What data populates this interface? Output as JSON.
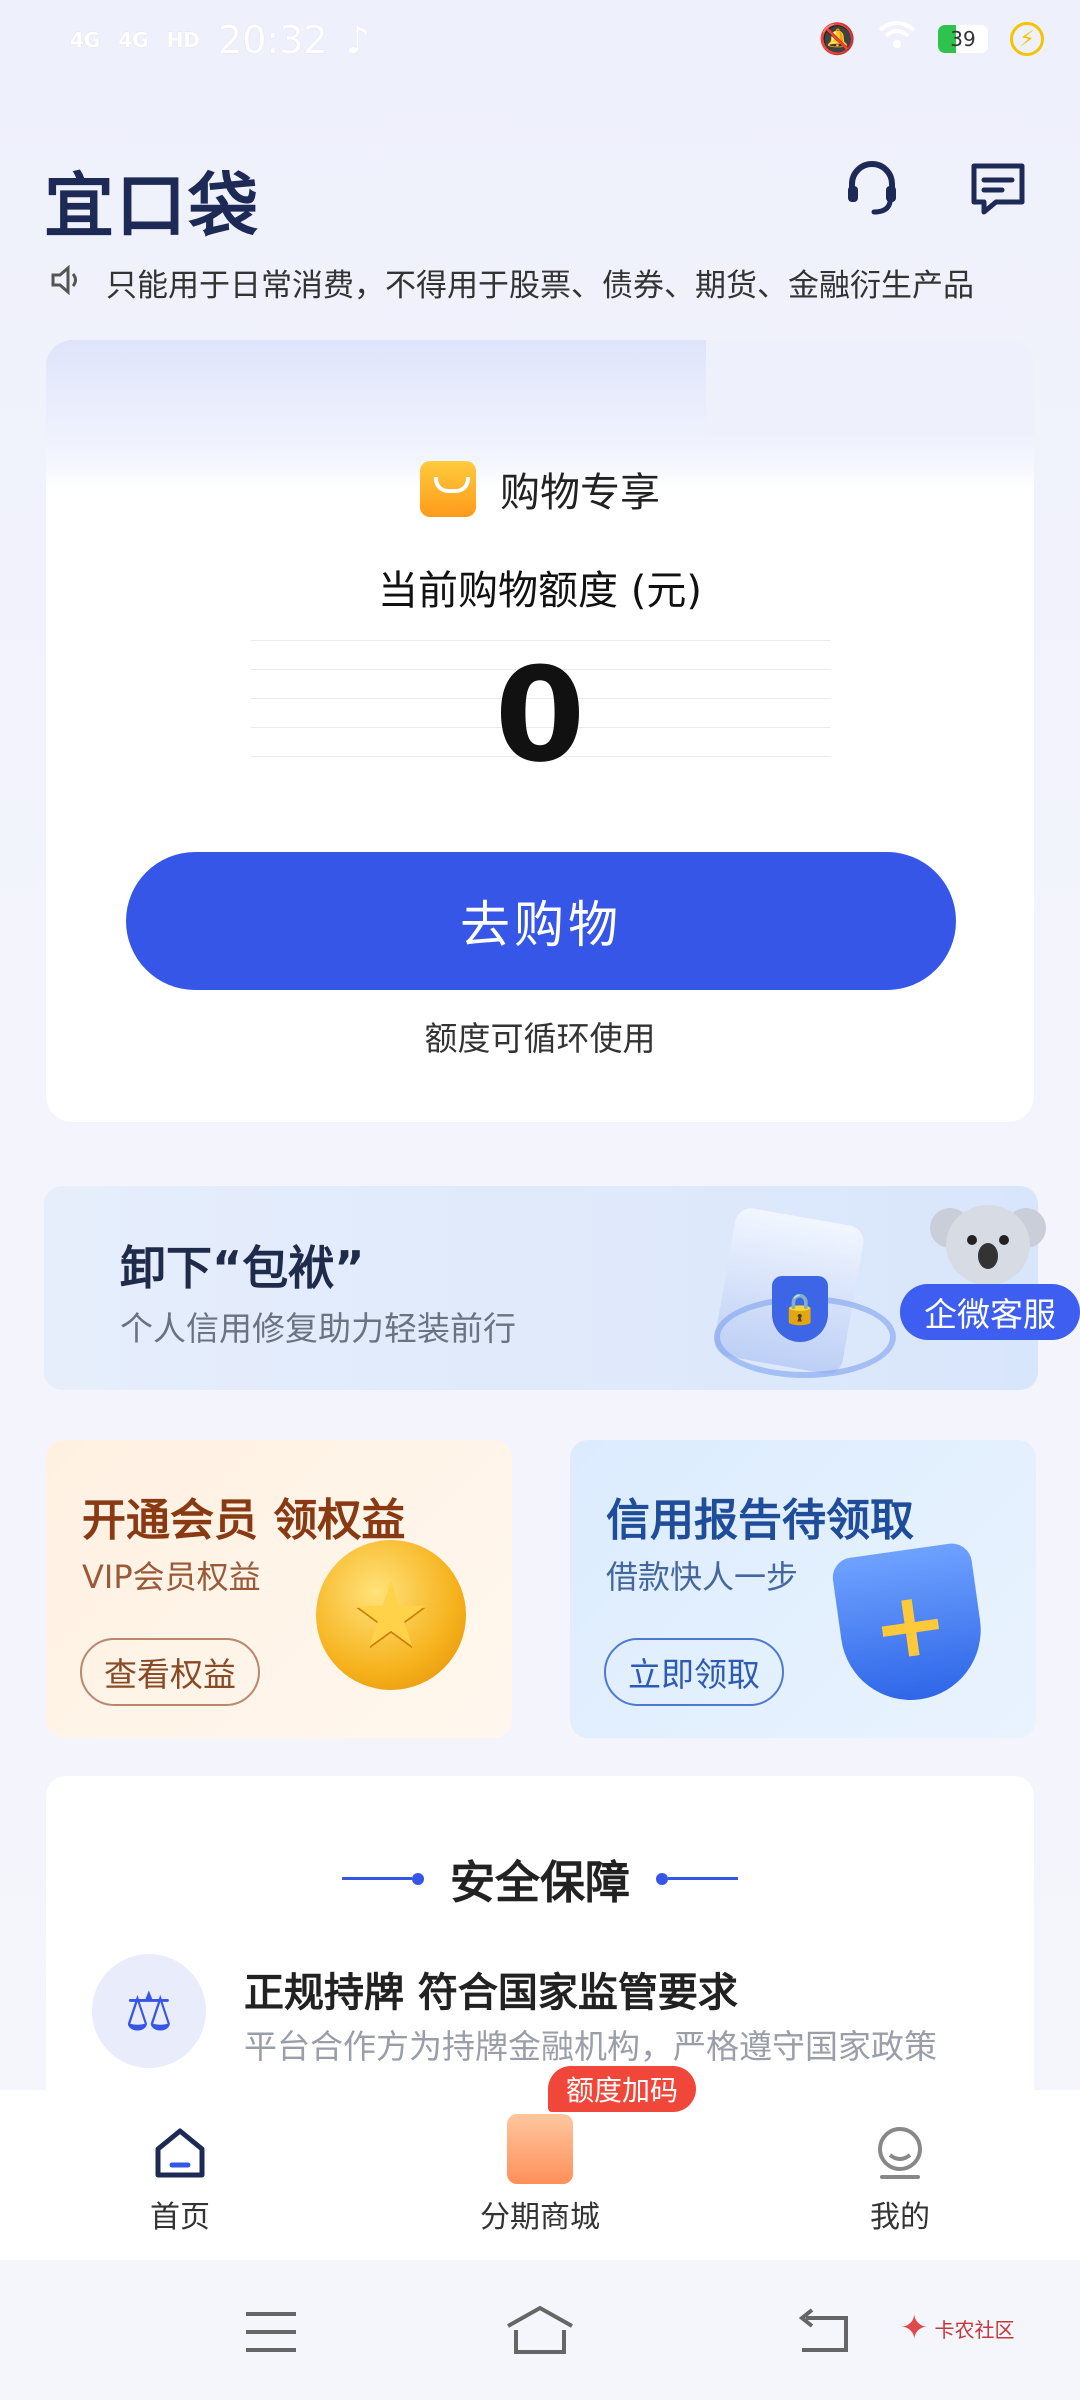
{
  "status_bar": {
    "signal_1": "4G",
    "signal_2": "4G",
    "hd": "HD",
    "time": "20:32",
    "battery": "39"
  },
  "header": {
    "logo": "宜口袋",
    "marquee": "只能用于日常消费，不得用于股票、债券、期货、金融衍生产品"
  },
  "shopping_card": {
    "title": "购物专享",
    "amount_label": "当前购物额度 (元)",
    "amount": "0",
    "button": "去购物",
    "note": "额度可循环使用"
  },
  "banner": {
    "title": "卸下“包袱”",
    "subtitle": "个人信用修复助力轻装前行",
    "badge": "企微客服"
  },
  "vip_card": {
    "title": "开通会员 领权益",
    "subtitle": "VIP会员权益",
    "button": "查看权益"
  },
  "credit_card": {
    "title": "信用报告待领取",
    "subtitle": "借款快人一步",
    "button": "立即领取"
  },
  "security": {
    "title": "安全保障",
    "item_title": "正规持牌 符合国家监管要求",
    "item_desc": "平台合作方为持牌金融机构，严格遵守国家政策"
  },
  "bottom_nav": {
    "home": "首页",
    "mall": "分期商城",
    "mall_tag": "额度加码",
    "mine": "我的"
  },
  "watermark": "卡农社区",
  "accent_color": "#3656e8"
}
